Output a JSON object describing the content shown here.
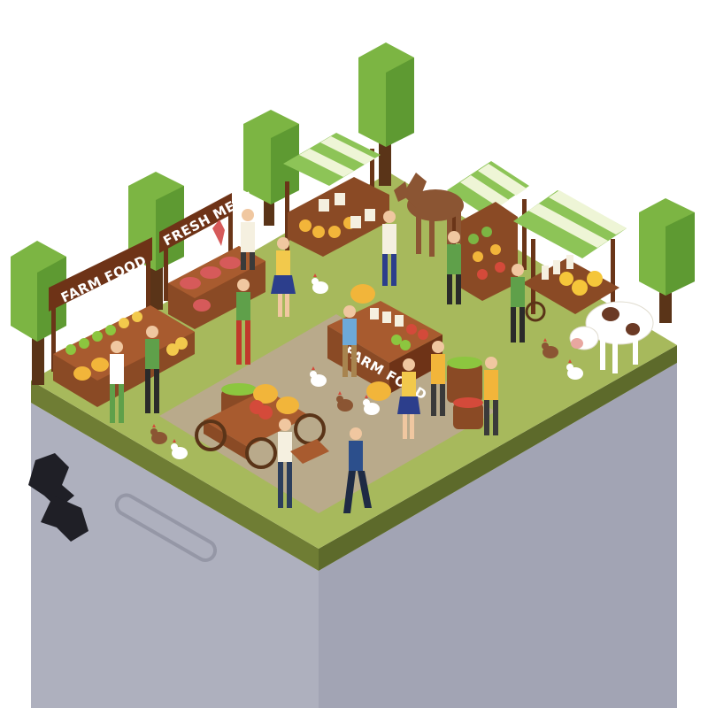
{
  "scene": {
    "signs": {
      "farm_food": "FARM FOOD",
      "fresh_meat": "FRESH MEAT",
      "center_stall": "FARM FOOD"
    }
  },
  "colors": {
    "grass_top": "#a5b85a",
    "path": "#b8a98a",
    "block_left": "#a8aab8",
    "block_right": "#9c9eae",
    "tree_green": "#7cb543",
    "tree_green_dark": "#5e9a32",
    "trunk": "#5a3418",
    "wood": "#8a4a25",
    "wood_dark": "#6a3518",
    "awning_green": "#8dc457",
    "awning_white": "#eef5d6",
    "sign_board": "#6e3317",
    "logo": "#1e1e24"
  },
  "icons": [
    "gear-logo-icon"
  ]
}
